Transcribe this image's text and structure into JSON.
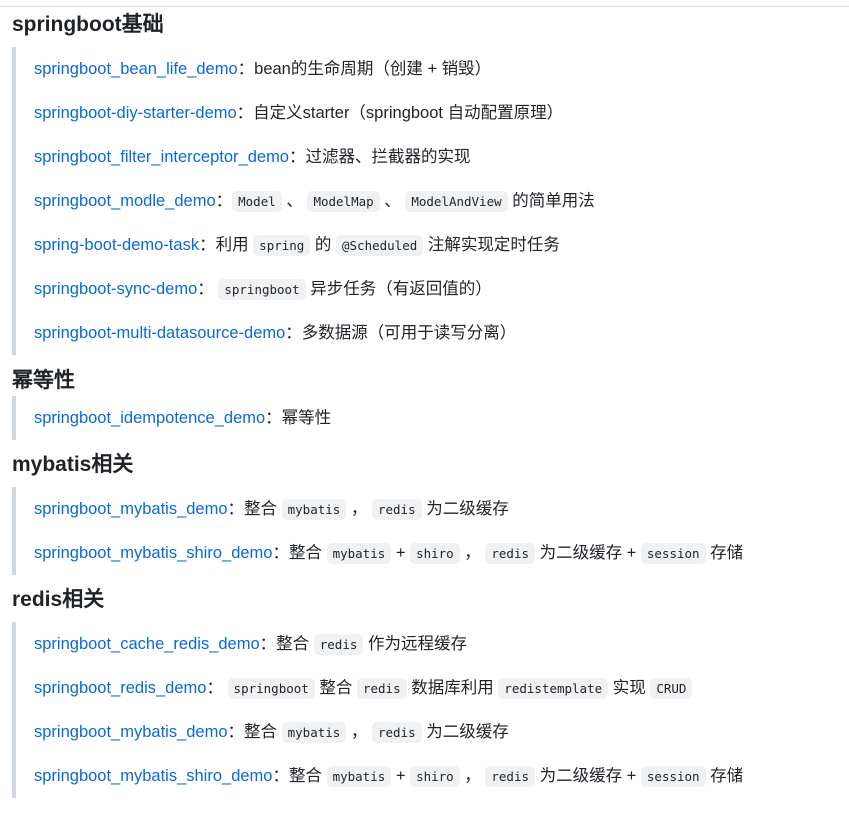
{
  "sections": [
    {
      "title": "springboot基础",
      "items": [
        {
          "link": "springboot_bean_life_demo",
          "parts": [
            {
              "t": "text",
              "v": "：bean的生命周期（创建 + 销毁）"
            }
          ]
        },
        {
          "link": "springboot-diy-starter-demo",
          "parts": [
            {
              "t": "text",
              "v": "：自定义starter（springboot 自动配置原理）"
            }
          ]
        },
        {
          "link": "springboot_filter_interceptor_demo",
          "parts": [
            {
              "t": "text",
              "v": "：过滤器、拦截器的实现"
            }
          ]
        },
        {
          "link": "springboot_modle_demo",
          "parts": [
            {
              "t": "text",
              "v": "："
            },
            {
              "t": "code",
              "v": "Model"
            },
            {
              "t": "text",
              "v": " 、 "
            },
            {
              "t": "code",
              "v": "ModelMap"
            },
            {
              "t": "text",
              "v": " 、 "
            },
            {
              "t": "code",
              "v": "ModelAndView"
            },
            {
              "t": "text",
              "v": " 的简单用法"
            }
          ]
        },
        {
          "link": "spring-boot-demo-task",
          "parts": [
            {
              "t": "text",
              "v": "：利用 "
            },
            {
              "t": "code",
              "v": "spring"
            },
            {
              "t": "text",
              "v": " 的 "
            },
            {
              "t": "code",
              "v": "@Scheduled"
            },
            {
              "t": "text",
              "v": " 注解实现定时任务"
            }
          ]
        },
        {
          "link": "springboot-sync-demo",
          "parts": [
            {
              "t": "text",
              "v": "： "
            },
            {
              "t": "code",
              "v": "springboot"
            },
            {
              "t": "text",
              "v": " 异步任务（有返回值的）"
            }
          ]
        },
        {
          "link": "springboot-multi-datasource-demo",
          "parts": [
            {
              "t": "text",
              "v": "：多数据源（可用于读写分离）"
            }
          ]
        }
      ]
    },
    {
      "title": "幂等性",
      "items": [
        {
          "link": "springboot_idempotence_demo",
          "parts": [
            {
              "t": "text",
              "v": "：幂等性"
            }
          ]
        }
      ]
    },
    {
      "title": "mybatis相关",
      "items": [
        {
          "link": "springboot_mybatis_demo",
          "parts": [
            {
              "t": "text",
              "v": "：整合 "
            },
            {
              "t": "code",
              "v": "mybatis"
            },
            {
              "t": "text",
              "v": " ， "
            },
            {
              "t": "code",
              "v": "redis"
            },
            {
              "t": "text",
              "v": " 为二级缓存"
            }
          ]
        },
        {
          "link": "springboot_mybatis_shiro_demo",
          "parts": [
            {
              "t": "text",
              "v": "：整合 "
            },
            {
              "t": "code",
              "v": "mybatis"
            },
            {
              "t": "text",
              "v": " + "
            },
            {
              "t": "code",
              "v": "shiro"
            },
            {
              "t": "text",
              "v": " ， "
            },
            {
              "t": "code",
              "v": "redis"
            },
            {
              "t": "text",
              "v": " 为二级缓存 + "
            },
            {
              "t": "code",
              "v": "session"
            },
            {
              "t": "text",
              "v": " 存储"
            }
          ]
        }
      ]
    },
    {
      "title": "redis相关",
      "items": [
        {
          "link": "springboot_cache_redis_demo",
          "parts": [
            {
              "t": "text",
              "v": "：整合 "
            },
            {
              "t": "code",
              "v": "redis"
            },
            {
              "t": "text",
              "v": " 作为远程缓存"
            }
          ]
        },
        {
          "link": "springboot_redis_demo",
          "parts": [
            {
              "t": "text",
              "v": "： "
            },
            {
              "t": "code",
              "v": "springboot"
            },
            {
              "t": "text",
              "v": " 整合 "
            },
            {
              "t": "code",
              "v": "redis"
            },
            {
              "t": "text",
              "v": " 数据库利用 "
            },
            {
              "t": "code",
              "v": "redistemplate"
            },
            {
              "t": "text",
              "v": " 实现 "
            },
            {
              "t": "code",
              "v": "CRUD"
            }
          ]
        },
        {
          "link": "springboot_mybatis_demo",
          "parts": [
            {
              "t": "text",
              "v": "：整合 "
            },
            {
              "t": "code",
              "v": "mybatis"
            },
            {
              "t": "text",
              "v": " ， "
            },
            {
              "t": "code",
              "v": "redis"
            },
            {
              "t": "text",
              "v": " 为二级缓存"
            }
          ]
        },
        {
          "link": "springboot_mybatis_shiro_demo",
          "parts": [
            {
              "t": "text",
              "v": "：整合 "
            },
            {
              "t": "code",
              "v": "mybatis"
            },
            {
              "t": "text",
              "v": " + "
            },
            {
              "t": "code",
              "v": "shiro"
            },
            {
              "t": "text",
              "v": " ， "
            },
            {
              "t": "code",
              "v": "redis"
            },
            {
              "t": "text",
              "v": " 为二级缓存 + "
            },
            {
              "t": "code",
              "v": "session"
            },
            {
              "t": "text",
              "v": " 存储"
            }
          ]
        }
      ]
    }
  ]
}
